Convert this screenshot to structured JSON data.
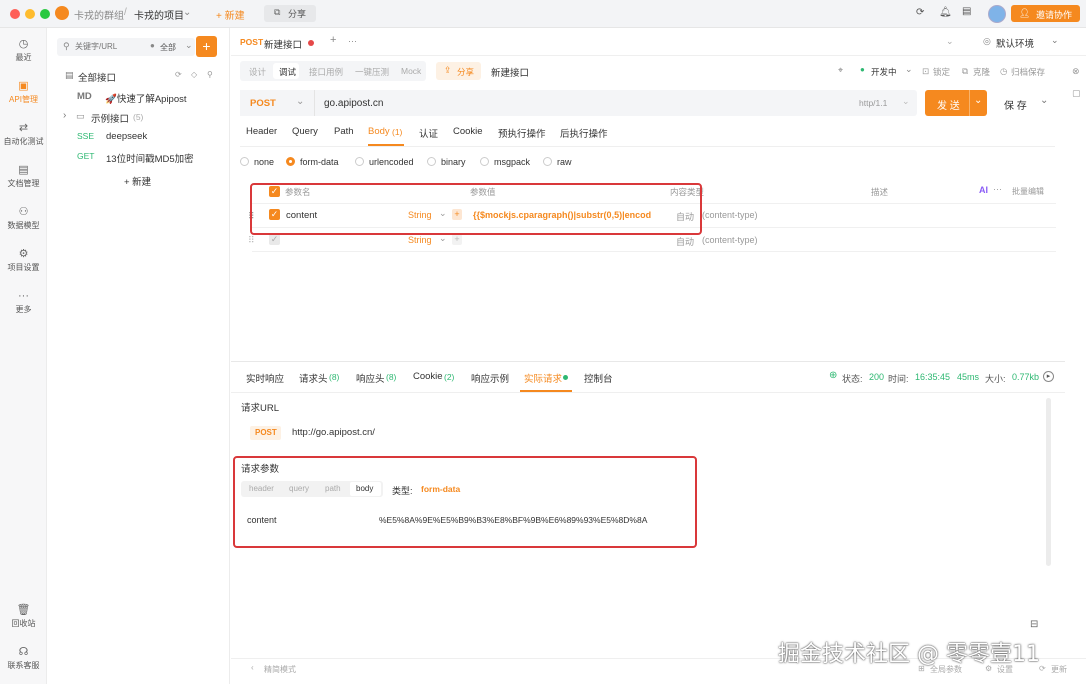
{
  "titlebar": {
    "team": "卡戎的群组",
    "separator": "/",
    "project": "卡戎的项目",
    "new_label": "+ 新建",
    "share_label": "分享",
    "invite_label": "邀请协作"
  },
  "sidebar": {
    "items": [
      {
        "label": "最近",
        "icon": "clock-icon"
      },
      {
        "label": "API管理",
        "icon": "api-icon"
      },
      {
        "label": "自动化测试",
        "icon": "automation-icon"
      },
      {
        "label": "文档管理",
        "icon": "document-icon"
      },
      {
        "label": "数据模型",
        "icon": "model-icon"
      },
      {
        "label": "项目设置",
        "icon": "settings-icon"
      },
      {
        "label": "更多",
        "icon": "more-icon"
      },
      {
        "label": "回收站",
        "icon": "trash-icon"
      },
      {
        "label": "联系客服",
        "icon": "headset-icon"
      }
    ]
  },
  "tree": {
    "search_placeholder": "关键字/URL",
    "filter": "全部",
    "all_label": "全部接口",
    "group_label": "示例接口",
    "group_count": "(5)",
    "items": [
      {
        "method": "MD",
        "name": "🚀快速了解Apipost"
      },
      {
        "method": "SSE",
        "name": "deepseek"
      },
      {
        "method": "GET",
        "name": "13位时间戳MD5加密"
      }
    ],
    "new_label": "+ 新建"
  },
  "doc_tabs": {
    "active_method": "POST",
    "active_name": "新建接口",
    "plus": "+",
    "more": "···",
    "env_label": "默认环境"
  },
  "subtabs": {
    "items": [
      "设计",
      "调试",
      "接口用例",
      "一键压测",
      "Mock"
    ],
    "active": "调试",
    "share": "分享",
    "api_name": "新建接口",
    "status": "开发中",
    "lock": "锁定",
    "clone": "克隆",
    "archive": "归档保存"
  },
  "request": {
    "method": "POST",
    "url": "go.apipost.cn",
    "protocol": "http/1.1",
    "send": "发 送",
    "save": "保 存"
  },
  "req_tabs": {
    "items": [
      "Header",
      "Query",
      "Path",
      "Body",
      "认证",
      "Cookie",
      "预执行操作",
      "后执行操作"
    ],
    "body_count": "(1)"
  },
  "body_types": {
    "options": [
      "none",
      "form-data",
      "urlencoded",
      "binary",
      "msgpack",
      "raw"
    ],
    "selected": "form-data"
  },
  "params_table": {
    "headers": {
      "name": "参数名",
      "value": "参数值",
      "type": "内容类型",
      "desc": "描述",
      "ai": "AI",
      "bulk": "批量编辑"
    },
    "rows": [
      {
        "name": "content",
        "kind": "String",
        "value": "{{$mockjs.cparagraph()|substr(0,5)|encod",
        "auto": "自动",
        "ctype": "(content-type)"
      },
      {
        "name": "",
        "kind": "String",
        "value": "",
        "auto": "自动",
        "ctype": "(content-type)"
      }
    ]
  },
  "resp_tabs": {
    "items": [
      "实时响应",
      "请求头",
      "响应头",
      "Cookie",
      "响应示例",
      "实际请求",
      "控制台"
    ],
    "counts": {
      "req_headers": "(8)",
      "resp_headers": "(8)",
      "cookie": "(2)"
    },
    "active": "实际请求",
    "status_label": "状态:",
    "status_code": "200",
    "time_label": "时间:",
    "time": "16:35:45",
    "duration": "45ms",
    "size_label": "大小:",
    "size": "0.77kb"
  },
  "actual_request": {
    "url_title": "请求URL",
    "method": "POST",
    "url": "http://go.apipost.cn/",
    "params_title": "请求参数",
    "param_tabs": [
      "header",
      "query",
      "path",
      "body"
    ],
    "type_label": "类型:",
    "type_value": "form-data",
    "param_name": "content",
    "param_value": "%E5%8A%9E%E5%B9%B3%E8%BF%9B%E6%89%93%E5%8D%8A"
  },
  "footer": {
    "mode": "精简模式",
    "global_params": "全局参数",
    "settings": "设置",
    "update": "更新"
  },
  "watermark": "掘金技术社区 @ 零零壹11",
  "colors": {
    "accent": "#f5891f",
    "highlight": "#d9383a",
    "success": "#2eb872"
  }
}
